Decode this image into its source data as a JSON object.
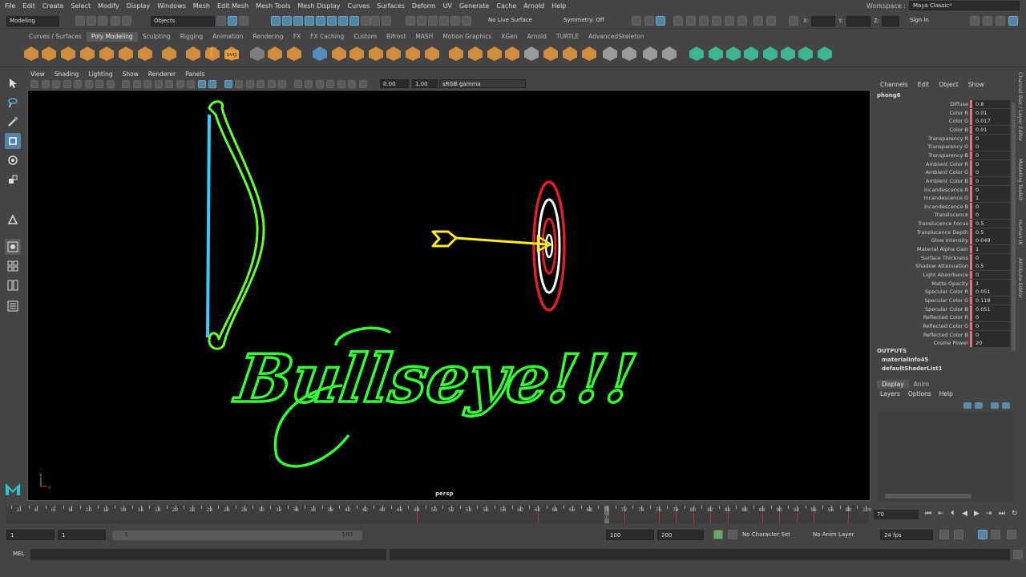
{
  "menubar": {
    "items": [
      "File",
      "Edit",
      "Create",
      "Select",
      "Modify",
      "Display",
      "Windows",
      "Mesh",
      "Edit Mesh",
      "Mesh Tools",
      "Mesh Display",
      "Curves",
      "Surfaces",
      "Deform",
      "UV",
      "Generate",
      "Cache",
      "Arnold",
      "Help"
    ],
    "workspace_label": "Workspace :",
    "workspace_value": "Maya Classic*"
  },
  "statusline": {
    "mode": "Modeling",
    "select_mode": "Objects",
    "live_surface": "No Live Surface",
    "symmetry": "Symmetry: Off",
    "x_label": "X:",
    "y_label": "Y:",
    "z_label": "Z:",
    "sign_in": "Sign In"
  },
  "shelf": {
    "tabs": [
      "Curves / Surfaces",
      "Poly Modeling",
      "Sculpting",
      "Rigging",
      "Animation",
      "Rendering",
      "FX",
      "FX Caching",
      "Custom",
      "Bifrost",
      "MASH",
      "Motion Graphics",
      "XGen",
      "Arnold",
      "TURTLE",
      "AdvancedSkeleton"
    ],
    "active_tab": "Poly Modeling",
    "svg_icon_text": "svg",
    "text_icon": "T"
  },
  "viewport": {
    "menu": [
      "View",
      "Shading",
      "Lighting",
      "Show",
      "Renderer",
      "Panels"
    ],
    "exposure": "0.00",
    "gamma": "1.00",
    "color_space": "sRGB gamma",
    "camera": "persp",
    "scene_text": "Bullseye!!!",
    "axis_labels": [
      "y",
      "x"
    ]
  },
  "channel_box": {
    "tabs": [
      "Channels",
      "Edit",
      "Object",
      "Show"
    ],
    "node": "phong6",
    "attributes": [
      {
        "name": "Diffuse",
        "value": "0.8"
      },
      {
        "name": "Color R",
        "value": "0.01"
      },
      {
        "name": "Color G",
        "value": "0.017"
      },
      {
        "name": "Color B",
        "value": "0.01"
      },
      {
        "name": "Transparency R",
        "value": "0"
      },
      {
        "name": "Transparency G",
        "value": "0"
      },
      {
        "name": "Transparency B",
        "value": "0"
      },
      {
        "name": "Ambient Color R",
        "value": "0"
      },
      {
        "name": "Ambient Color G",
        "value": "0"
      },
      {
        "name": "Ambient Color B",
        "value": "0"
      },
      {
        "name": "Incandescence R",
        "value": "0"
      },
      {
        "name": "Incandescence G",
        "value": "1"
      },
      {
        "name": "Incandescence B",
        "value": "0"
      },
      {
        "name": "Translucence",
        "value": "0"
      },
      {
        "name": "Translucence Focus",
        "value": "0.5"
      },
      {
        "name": "Translucence Depth",
        "value": "0.5"
      },
      {
        "name": "Glow Intensity",
        "value": "0.049"
      },
      {
        "name": "Material Alpha Gain",
        "value": "1"
      },
      {
        "name": "Surface Thickness",
        "value": "0"
      },
      {
        "name": "Shadow Attenuation",
        "value": "0.5"
      },
      {
        "name": "Light Absorbance",
        "value": "0"
      },
      {
        "name": "Matte Opacity",
        "value": "1"
      },
      {
        "name": "Specular Color R",
        "value": "0.051"
      },
      {
        "name": "Specular Color G",
        "value": "0.118"
      },
      {
        "name": "Specular Color B",
        "value": "0.051"
      },
      {
        "name": "Reflected Color R",
        "value": "0"
      },
      {
        "name": "Reflected Color G",
        "value": "0"
      },
      {
        "name": "Reflected Color B",
        "value": "0"
      },
      {
        "name": "Cosine Power",
        "value": "20"
      }
    ],
    "outputs_label": "OUTPUTS",
    "outputs": [
      "materialInfo45",
      "defaultShaderList1"
    ]
  },
  "layer_editor": {
    "tabs": [
      "Display",
      "Anim"
    ],
    "active_tab": "Display",
    "menu": [
      "Layers",
      "Options",
      "Help"
    ]
  },
  "side_tabs": [
    "Channel Box / Layer Editor",
    "Modeling Toolkit",
    "Human IK",
    "Attribute Editor"
  ],
  "timeline": {
    "labels": [
      "2",
      "4",
      "6",
      "8",
      "10",
      "12",
      "14",
      "16",
      "18",
      "20",
      "22",
      "24",
      "26",
      "28",
      "30",
      "32",
      "34",
      "36",
      "38",
      "40",
      "42",
      "44",
      "46",
      "48",
      "50",
      "52",
      "54",
      "56",
      "58",
      "60",
      "62",
      "64",
      "66",
      "68",
      "70",
      "72",
      "74",
      "76",
      "78",
      "80",
      "82",
      "84",
      "86",
      "88",
      "90",
      "92",
      "94",
      "96",
      "98",
      "100"
    ],
    "key_frames": [
      48,
      62,
      72,
      76,
      78,
      80,
      82,
      84,
      88,
      90,
      92,
      94,
      98
    ],
    "current_frame": "70",
    "range_start": 1,
    "range_end": 100
  },
  "range": {
    "start": "1",
    "start_inner": "1",
    "range_low": "1",
    "range_high": "100",
    "end_inner": "100",
    "end": "200",
    "character_set": "No Character Set",
    "anim_layer": "No Anim Layer",
    "fps": "24 fps"
  },
  "command_line": {
    "label": "MEL"
  },
  "colors": {
    "bow": "#66ff33",
    "string": "#33ccff",
    "arrow": "#ffee22",
    "target_red": "#dd2222",
    "text": "#33ff33",
    "accent": "#5285a6"
  }
}
